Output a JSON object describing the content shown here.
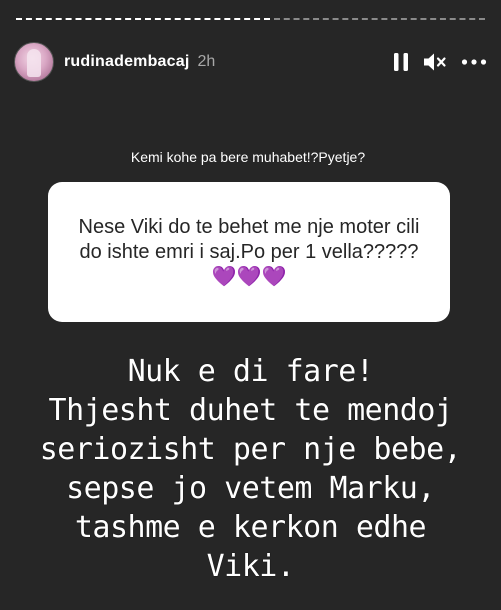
{
  "story": {
    "username": "rudinadembacaj",
    "time": "2h",
    "icons": {
      "pause": "pause-icon",
      "mute": "speaker-muted-icon",
      "more": "more-horizontal-icon"
    }
  },
  "question": {
    "prompt": "Kemi kohe pa bere muhabet!?Pyetje?",
    "text": "Nese Viki do te behet me nje moter cili do ishte emri i saj.Po per 1 vella?????💜💜💜"
  },
  "reply": {
    "lines": [
      "Nuk e di fare!",
      "Thjesht duhet te mendoj",
      "seriozisht per nje bebe,",
      "sepse jo vetem Marku,",
      "tashme e kerkon edhe",
      "Viki."
    ]
  },
  "colors": {
    "background": "#262626",
    "card": "#ffffff",
    "text": "#ffffff",
    "muted": "#a8a8a8"
  }
}
